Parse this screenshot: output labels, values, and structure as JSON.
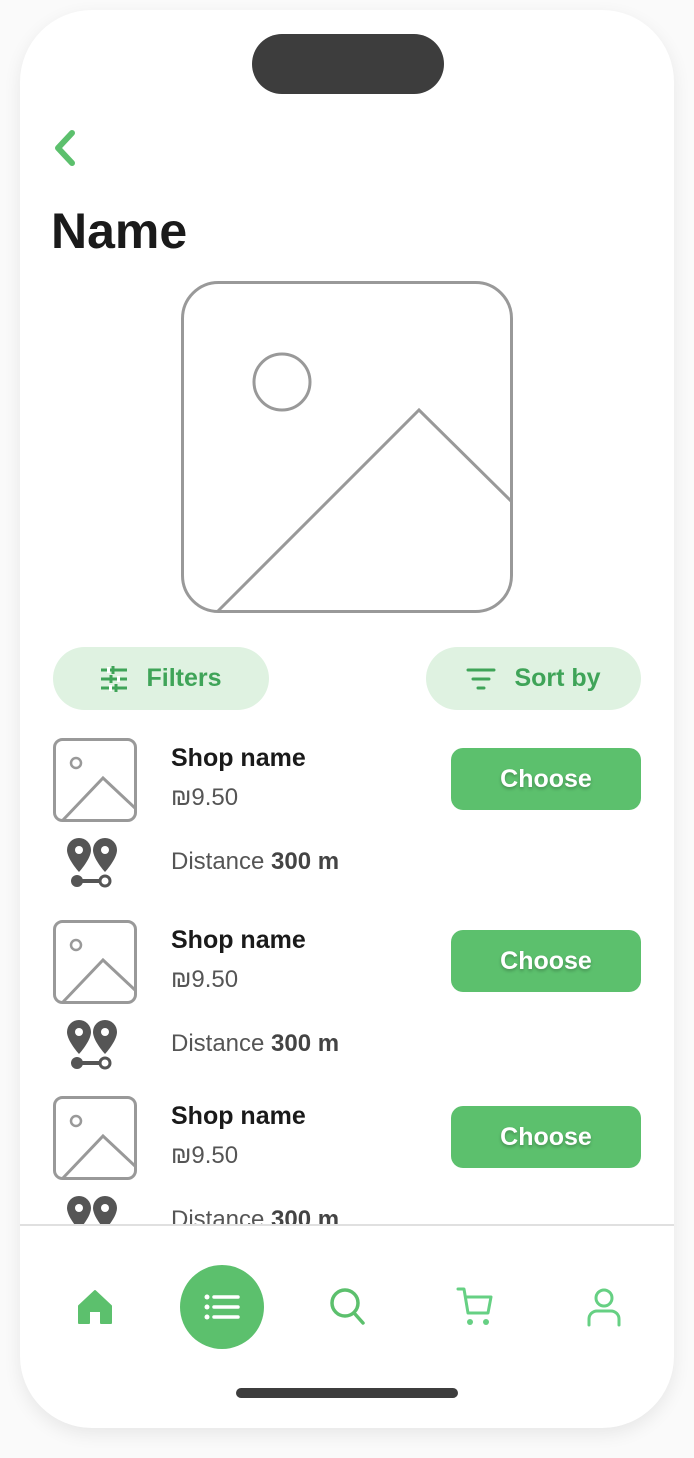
{
  "header": {
    "title": "Name"
  },
  "toolbar": {
    "filters_label": "Filters",
    "sort_label": "Sort by"
  },
  "shops": [
    {
      "name": "Shop name",
      "price": "₪9.50",
      "distance_label": "Distance",
      "distance_value": "300 m",
      "button": "Choose"
    },
    {
      "name": "Shop name",
      "price": "₪9.50",
      "distance_label": "Distance",
      "distance_value": "300 m",
      "button": "Choose"
    },
    {
      "name": "Shop name",
      "price": "₪9.50",
      "distance_label": "Distance",
      "distance_value": "300 m",
      "button": "Choose"
    }
  ],
  "nav": {
    "items": [
      "home-icon",
      "list-icon",
      "search-icon",
      "cart-icon",
      "user-icon"
    ],
    "active": "list"
  },
  "colors": {
    "accent": "#5cc06d",
    "accent_light": "#dff2e1",
    "accent_text": "#3fa458"
  }
}
